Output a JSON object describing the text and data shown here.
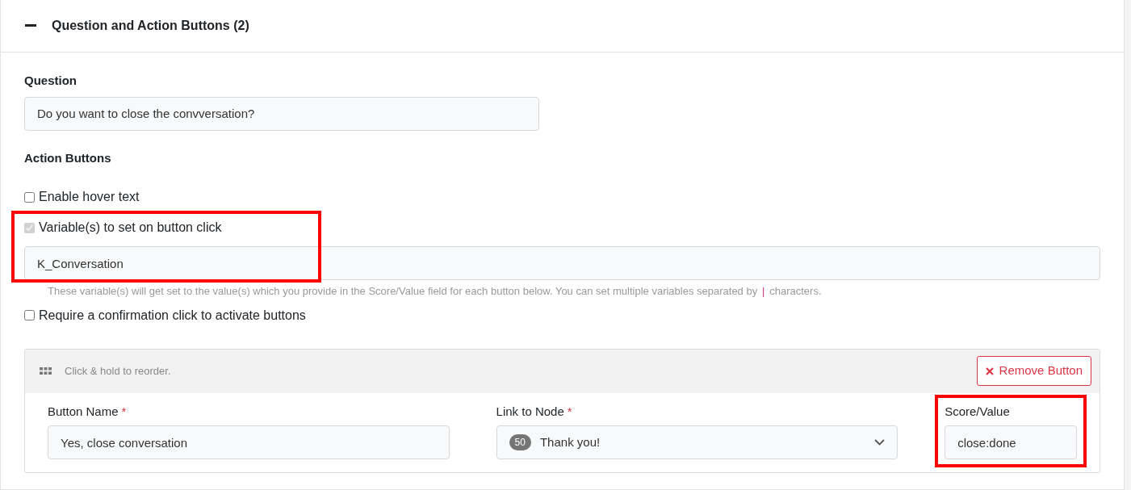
{
  "section": {
    "title": "Question and Action Buttons (2)",
    "expanded": true
  },
  "question": {
    "label": "Question",
    "value": "Do you want to close the convversation?"
  },
  "action_buttons": {
    "label": "Action Buttons",
    "options": [
      {
        "label": "Enable hover text",
        "checked": false,
        "disabled": false
      },
      {
        "label": "Variable(s) to set on button click",
        "checked": true,
        "disabled": true,
        "highlighted": true
      },
      {
        "label": "Require a confirmation click to activate buttons",
        "checked": false,
        "disabled": false
      }
    ],
    "variables": {
      "value": "K_Conversation",
      "help_before": "These variable(s) will get set to the value(s) which you provide in the Score/Value field for each button below. You can set multiple variables separated by",
      "help_code": "|",
      "help_after": "characters."
    }
  },
  "button_item": {
    "reorder_hint": "Click & hold to reorder.",
    "remove_label": "Remove Button",
    "fields": [
      {
        "kind": "text",
        "label": "Button Name",
        "required_mark": "*",
        "value": "Yes, close conversation"
      },
      {
        "kind": "select",
        "label": "Link to Node",
        "required_mark": "*",
        "badge": "50",
        "value": "Thank you!"
      },
      {
        "kind": "text",
        "label": "Score/Value",
        "highlighted": true,
        "value": "close:done"
      }
    ]
  }
}
